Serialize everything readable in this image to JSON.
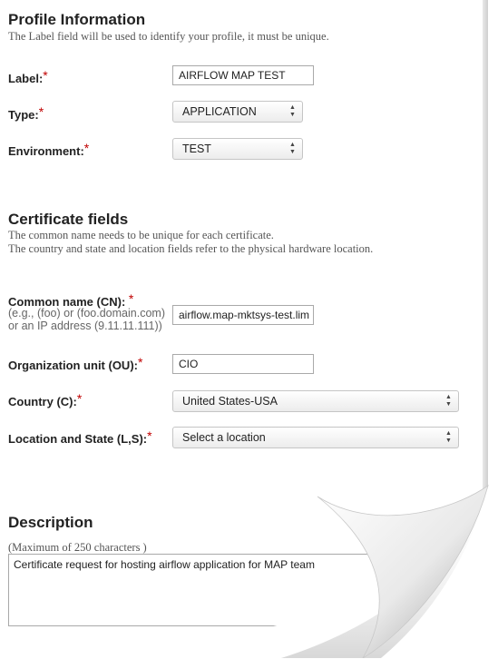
{
  "profile": {
    "title": "Profile Information",
    "subtitle": "The Label field will be used to identify your profile, it must be unique.",
    "label": {
      "text": "Label:",
      "value": "AIRFLOW MAP TEST"
    },
    "type": {
      "text": "Type:",
      "value": "APPLICATION"
    },
    "environment": {
      "text": "Environment:",
      "value": "TEST"
    }
  },
  "certificate": {
    "title": "Certificate fields",
    "subtitle_line1": "The common name needs to be unique for each certificate.",
    "subtitle_line2": "The country and state and location fields refer to the physical hardware location.",
    "cn": {
      "text": "Common name (CN):",
      "hint_line1": "(e.g., (foo) or (foo.domain.com)",
      "hint_line2": "or an IP address (9.11.11.111))",
      "value": "airflow.map-mktsys-test.lim"
    },
    "ou": {
      "text": "Organization unit (OU):",
      "value": "CIO"
    },
    "country": {
      "text": "Country (C):",
      "value": "United States-USA"
    },
    "location": {
      "text": "Location and State (L,S):",
      "value": "Select a location"
    }
  },
  "description": {
    "title": "Description",
    "hint": "(Maximum of 250 characters )",
    "value": "Certificate request for hosting airflow application for MAP team"
  },
  "required_marker": "*",
  "icons": {
    "select_arrows": "updown-arrows-icon"
  }
}
